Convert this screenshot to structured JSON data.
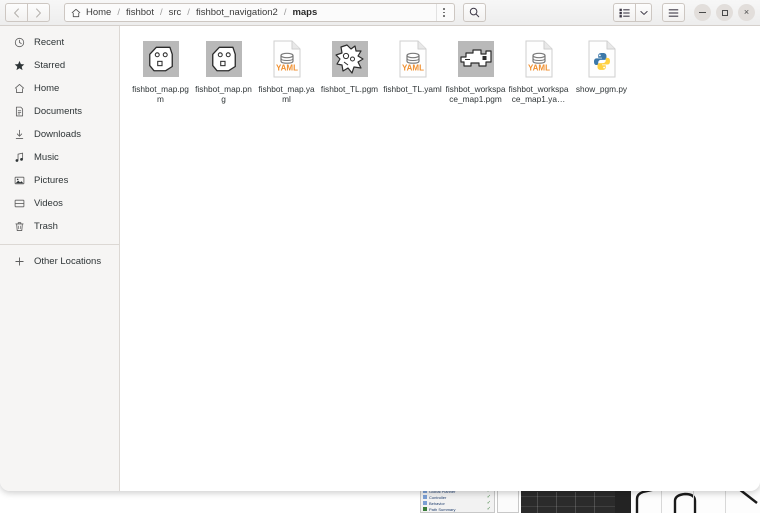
{
  "window": {
    "title": "maps",
    "nav": {
      "back_label": "‹",
      "forward_label": "›"
    }
  },
  "breadcrumb": {
    "home_icon": "home-icon",
    "separator": "/",
    "items": [
      {
        "label": "Home",
        "current": false
      },
      {
        "label": "fishbot",
        "current": false
      },
      {
        "label": "src",
        "current": false
      },
      {
        "label": "fishbot_navigation2",
        "current": false
      },
      {
        "label": "maps",
        "current": true
      }
    ]
  },
  "toolbar": {
    "path_menu_icon": "dots-vertical-icon",
    "search_icon": "search-icon",
    "view_list_icon": "list-view-icon",
    "view_dropdown_icon": "chevron-down-icon",
    "app_menu_icon": "hamburger-menu-icon",
    "minimize_icon": "minimize-icon",
    "maximize_icon": "maximize-icon",
    "close_icon": "close-icon",
    "close_label": "×"
  },
  "sidebar": {
    "items": [
      {
        "label": "Recent",
        "icon": "clock-icon"
      },
      {
        "label": "Starred",
        "icon": "star-icon"
      },
      {
        "label": "Home",
        "icon": "home-icon"
      },
      {
        "label": "Documents",
        "icon": "document-icon"
      },
      {
        "label": "Downloads",
        "icon": "download-icon"
      },
      {
        "label": "Music",
        "icon": "music-note-icon"
      },
      {
        "label": "Pictures",
        "icon": "picture-icon"
      },
      {
        "label": "Videos",
        "icon": "video-icon"
      },
      {
        "label": "Trash",
        "icon": "trash-icon"
      }
    ],
    "other_locations": {
      "label": "Other Locations",
      "icon": "plus-icon"
    }
  },
  "files": [
    {
      "name": "fishbot_map.pgm",
      "type": "map-image",
      "icon": "map-thumbnail-hexagon"
    },
    {
      "name": "fishbot_map.png",
      "type": "map-image",
      "icon": "map-thumbnail-hexagon"
    },
    {
      "name": "fishbot_map.yaml",
      "type": "yaml",
      "icon": "yaml-file-icon"
    },
    {
      "name": "fishbot_TL.pgm",
      "type": "map-image",
      "icon": "map-thumbnail-blob"
    },
    {
      "name": "fishbot_TL.yaml",
      "type": "yaml",
      "icon": "yaml-file-icon"
    },
    {
      "name": "fishbot_workspace_map1.pgm",
      "type": "map-image",
      "icon": "map-thumbnail-workspace"
    },
    {
      "name": "fishbot_workspace_map1.ya…",
      "type": "yaml",
      "icon": "yaml-file-icon"
    },
    {
      "name": "show_pgm.py",
      "type": "python",
      "icon": "python-file-icon"
    }
  ],
  "background": {
    "rviz_tree_rows": [
      {
        "label": "Global Planner"
      },
      {
        "label": "Controller"
      },
      {
        "label": "Behavior"
      },
      {
        "label": "Path Summary"
      }
    ]
  },
  "colors": {
    "headerbar_top": "#f7f7f7",
    "headerbar_bottom": "#ededed",
    "sidebar_bg": "#f6f5f4",
    "content_bg": "#ffffff",
    "border": "#d5d0cc",
    "text": "#2e3436",
    "yaml_accent": "#f08f2e",
    "python_blue": "#3c78a9",
    "python_yellow": "#ffd champion"
  }
}
